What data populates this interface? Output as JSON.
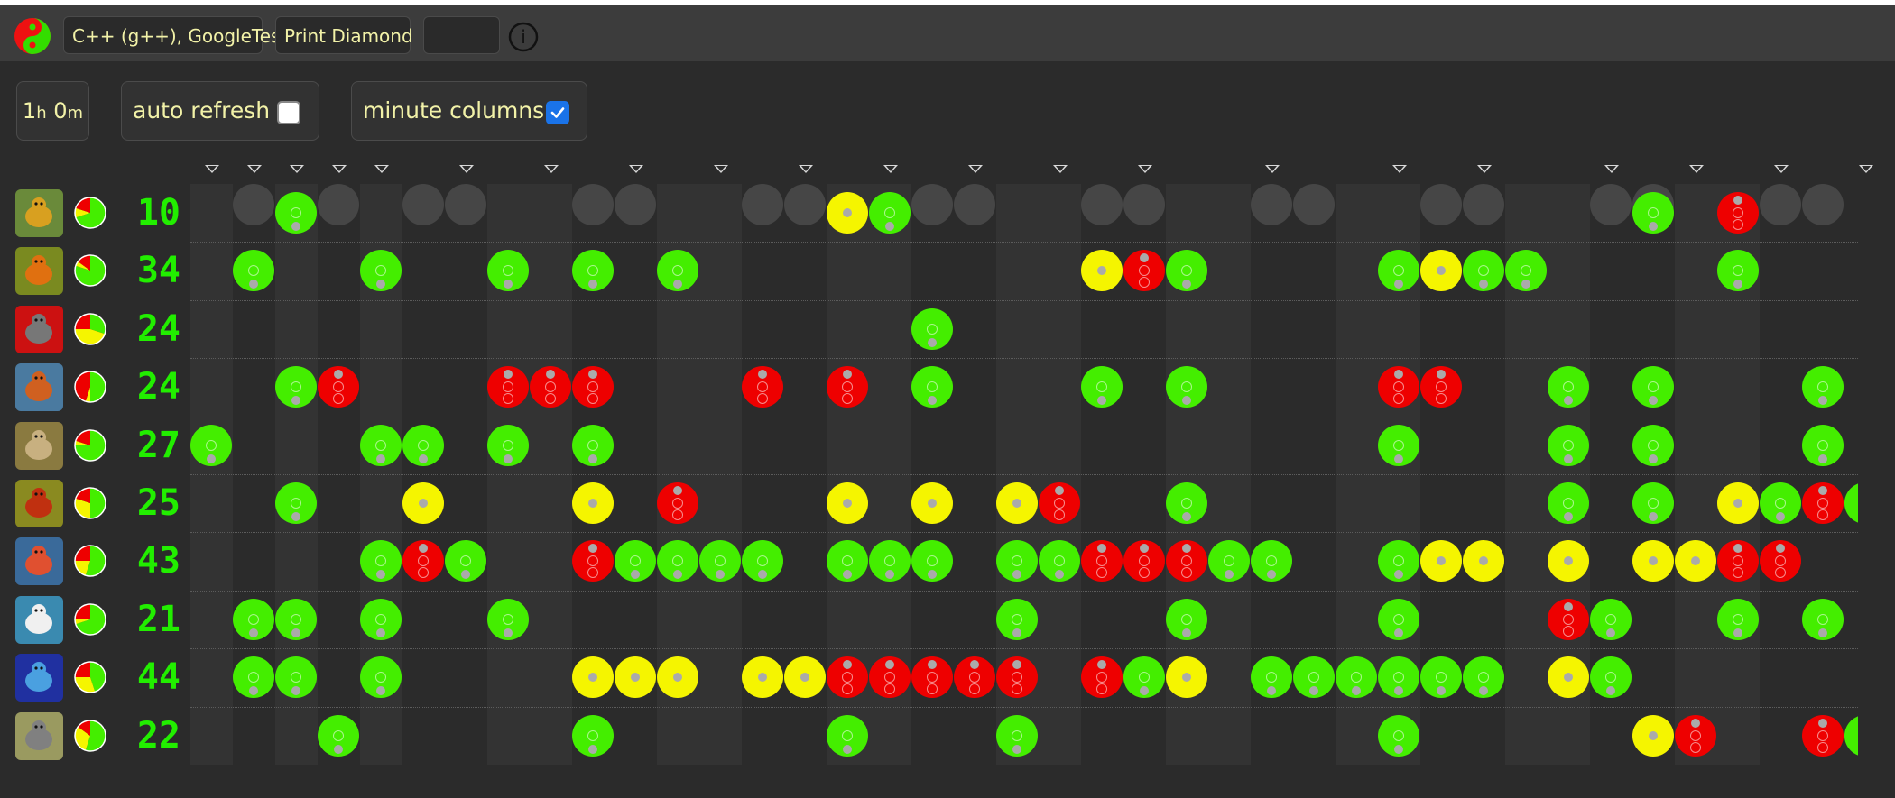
{
  "header": {
    "language_label": "C++ (g++), GoogleTest",
    "exercise_label": "Print Diamond",
    "blank_label": "",
    "info_label": "i"
  },
  "controls": {
    "duration": {
      "h": "1",
      "h_unit": "h",
      "m": "0",
      "m_unit": "m"
    },
    "auto_refresh_label": "auto refresh",
    "auto_refresh_checked": false,
    "minute_columns_label": "minute columns",
    "minute_columns_checked": true
  },
  "colors": {
    "green": "#44ee00",
    "yellow": "#f5f500",
    "red": "#ee0000",
    "count": "#22ee00"
  },
  "markers_cols": [
    0,
    1,
    2,
    3,
    4,
    6,
    8,
    10,
    12,
    14,
    16,
    18,
    20,
    22,
    25,
    28,
    30,
    33,
    35,
    37,
    39
  ],
  "column_shading": [
    "dark",
    "light",
    "dark",
    "light",
    "dark",
    "light",
    "light",
    "dark",
    "dark",
    "light",
    "light",
    "dark",
    "dark",
    "light",
    "light",
    "dark",
    "dark",
    "light",
    "light",
    "dark",
    "dark",
    "light",
    "light",
    "dark",
    "dark",
    "light",
    "light",
    "dark",
    "dark",
    "light",
    "light",
    "dark",
    "dark",
    "light",
    "light",
    "dark",
    "dark",
    "light",
    "light"
  ],
  "teams": [
    {
      "animal": "bee",
      "icon": "bee-icon",
      "count": "10",
      "pie": {
        "green": 0.7,
        "yellow": 0.1,
        "red": 0.2
      },
      "lights": [
        [
          2,
          "green"
        ],
        [
          15,
          "yellow"
        ],
        [
          16,
          "green"
        ],
        [
          34,
          "green"
        ],
        [
          36,
          "red"
        ]
      ]
    },
    {
      "animal": "butterfly",
      "icon": "butterfly-icon",
      "count": "34",
      "pie": {
        "green": 0.8,
        "yellow": 0.05,
        "red": 0.15
      },
      "lights": [
        [
          1,
          "green"
        ],
        [
          4,
          "green"
        ],
        [
          7,
          "green"
        ],
        [
          9,
          "green"
        ],
        [
          11,
          "green"
        ],
        [
          21,
          "yellow"
        ],
        [
          22,
          "red"
        ],
        [
          23,
          "green"
        ],
        [
          28,
          "green"
        ],
        [
          29,
          "yellow"
        ],
        [
          30,
          "green"
        ],
        [
          31,
          "green"
        ],
        [
          36,
          "green"
        ]
      ]
    },
    {
      "animal": "elephant",
      "icon": "elephant-icon",
      "count": "24",
      "pie": {
        "green": 0.3,
        "yellow": 0.45,
        "red": 0.25
      },
      "lights": [
        [
          17,
          "green"
        ]
      ]
    },
    {
      "animal": "fox",
      "icon": "fox-icon",
      "count": "24",
      "pie": {
        "green": 0.5,
        "yellow": 0.05,
        "red": 0.45
      },
      "lights": [
        [
          2,
          "green"
        ],
        [
          3,
          "red"
        ],
        [
          7,
          "red"
        ],
        [
          8,
          "red"
        ],
        [
          9,
          "red"
        ],
        [
          13,
          "red"
        ],
        [
          15,
          "red"
        ],
        [
          17,
          "green"
        ],
        [
          21,
          "green"
        ],
        [
          23,
          "green"
        ],
        [
          28,
          "red"
        ],
        [
          29,
          "red"
        ],
        [
          32,
          "green"
        ],
        [
          34,
          "green"
        ],
        [
          38,
          "green"
        ]
      ]
    },
    {
      "animal": "monkey",
      "icon": "monkey-icon",
      "count": "27",
      "pie": {
        "green": 0.75,
        "yellow": 0.05,
        "red": 0.2
      },
      "lights": [
        [
          0,
          "green"
        ],
        [
          4,
          "green"
        ],
        [
          5,
          "green"
        ],
        [
          7,
          "green"
        ],
        [
          9,
          "green"
        ],
        [
          28,
          "green"
        ],
        [
          32,
          "green"
        ],
        [
          34,
          "green"
        ],
        [
          38,
          "green"
        ]
      ]
    },
    {
      "animal": "lobster",
      "icon": "lobster-icon",
      "count": "25",
      "pie": {
        "green": 0.5,
        "yellow": 0.3,
        "red": 0.2
      },
      "lights": [
        [
          2,
          "green"
        ],
        [
          5,
          "yellow"
        ],
        [
          9,
          "yellow"
        ],
        [
          11,
          "red"
        ],
        [
          15,
          "yellow"
        ],
        [
          17,
          "yellow"
        ],
        [
          19,
          "yellow"
        ],
        [
          20,
          "red"
        ],
        [
          23,
          "green"
        ],
        [
          32,
          "green"
        ],
        [
          34,
          "green"
        ],
        [
          36,
          "yellow"
        ],
        [
          37,
          "green"
        ],
        [
          38,
          "red"
        ],
        [
          39,
          "green"
        ]
      ]
    },
    {
      "animal": "squid",
      "icon": "squid-icon",
      "count": "43",
      "pie": {
        "green": 0.55,
        "yellow": 0.2,
        "red": 0.25
      },
      "lights": [
        [
          4,
          "green"
        ],
        [
          5,
          "red"
        ],
        [
          6,
          "green"
        ],
        [
          9,
          "red"
        ],
        [
          10,
          "green"
        ],
        [
          11,
          "green"
        ],
        [
          12,
          "green"
        ],
        [
          13,
          "green"
        ],
        [
          15,
          "green"
        ],
        [
          16,
          "green"
        ],
        [
          17,
          "green"
        ],
        [
          19,
          "green"
        ],
        [
          20,
          "green"
        ],
        [
          21,
          "red"
        ],
        [
          22,
          "red"
        ],
        [
          23,
          "red"
        ],
        [
          24,
          "green"
        ],
        [
          25,
          "green"
        ],
        [
          28,
          "green"
        ],
        [
          29,
          "yellow"
        ],
        [
          30,
          "yellow"
        ],
        [
          32,
          "yellow"
        ],
        [
          34,
          "yellow"
        ],
        [
          35,
          "yellow"
        ],
        [
          36,
          "red"
        ],
        [
          37,
          "red"
        ]
      ]
    },
    {
      "animal": "swan",
      "icon": "swan-icon",
      "count": "21",
      "pie": {
        "green": 0.7,
        "yellow": 0.05,
        "red": 0.25
      },
      "lights": [
        [
          1,
          "green"
        ],
        [
          2,
          "green"
        ],
        [
          4,
          "green"
        ],
        [
          7,
          "green"
        ],
        [
          19,
          "green"
        ],
        [
          23,
          "green"
        ],
        [
          28,
          "green"
        ],
        [
          32,
          "red"
        ],
        [
          33,
          "green"
        ],
        [
          36,
          "green"
        ],
        [
          38,
          "green"
        ]
      ]
    },
    {
      "animal": "shark",
      "icon": "shark-icon",
      "count": "44",
      "pie": {
        "green": 0.45,
        "yellow": 0.3,
        "red": 0.25
      },
      "lights": [
        [
          1,
          "green"
        ],
        [
          2,
          "green"
        ],
        [
          4,
          "green"
        ],
        [
          9,
          "yellow"
        ],
        [
          10,
          "yellow"
        ],
        [
          11,
          "yellow"
        ],
        [
          13,
          "yellow"
        ],
        [
          14,
          "yellow"
        ],
        [
          15,
          "red"
        ],
        [
          16,
          "red"
        ],
        [
          17,
          "red"
        ],
        [
          18,
          "red"
        ],
        [
          19,
          "red"
        ],
        [
          21,
          "red"
        ],
        [
          22,
          "green"
        ],
        [
          23,
          "yellow"
        ],
        [
          25,
          "green"
        ],
        [
          26,
          "green"
        ],
        [
          27,
          "green"
        ],
        [
          28,
          "green"
        ],
        [
          29,
          "green"
        ],
        [
          30,
          "green"
        ],
        [
          32,
          "yellow"
        ],
        [
          33,
          "green"
        ]
      ]
    },
    {
      "animal": "wolf",
      "icon": "wolf-icon",
      "count": "22",
      "pie": {
        "green": 0.55,
        "yellow": 0.3,
        "red": 0.15
      },
      "lights": [
        [
          3,
          "green"
        ],
        [
          9,
          "green"
        ],
        [
          15,
          "green"
        ],
        [
          19,
          "green"
        ],
        [
          28,
          "green"
        ],
        [
          34,
          "yellow"
        ],
        [
          35,
          "red"
        ],
        [
          38,
          "red"
        ],
        [
          39,
          "green"
        ]
      ]
    }
  ]
}
